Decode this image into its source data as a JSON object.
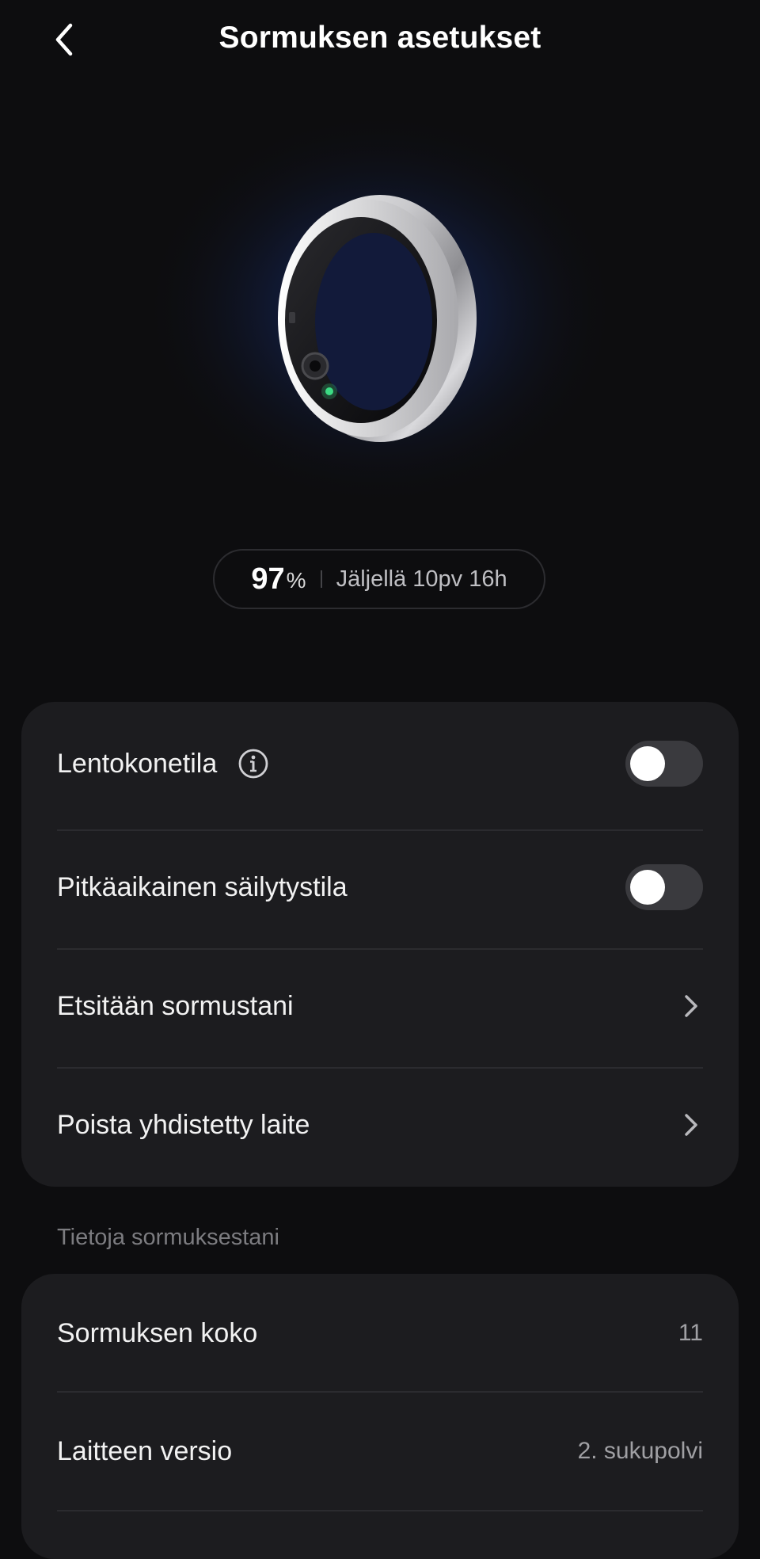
{
  "header": {
    "title": "Sormuksen asetukset",
    "back_icon": "chevron-left-icon"
  },
  "battery": {
    "percent": "97",
    "unit": "%",
    "remaining": "Jäljellä 10pv 16h"
  },
  "settings": {
    "airplane_mode": {
      "label": "Lentokonetila",
      "enabled": false,
      "info_icon": "info-icon"
    },
    "storage_mode": {
      "label": "Pitkäaikainen säilytystila",
      "enabled": false
    },
    "find_ring": {
      "label": "Etsitään sormustani"
    },
    "remove_device": {
      "label": "Poista yhdistetty laite"
    }
  },
  "info": {
    "heading": "Tietoja sormuksestani",
    "ring_size": {
      "label": "Sormuksen koko",
      "value": "11"
    },
    "device_version": {
      "label": "Laitteen versio",
      "value": "2. sukupolvi"
    }
  },
  "colors": {
    "background": "#0d0d0f",
    "card": "#1c1c1f",
    "toggle_off": "#3a3a3e",
    "led": "#3ddc84"
  }
}
